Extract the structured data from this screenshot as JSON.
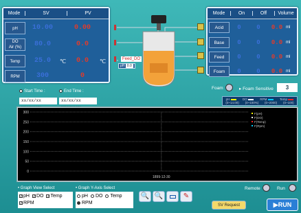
{
  "sensor_table": {
    "headers": [
      "Mode",
      "SV",
      "PV"
    ],
    "rows": [
      {
        "label": "pH",
        "sv": "10.00",
        "pv": "0.00",
        "unit": ""
      },
      {
        "label": "DO\nAir (%)",
        "label1": "DO",
        "label2": "Air (%)",
        "sv": "80.0",
        "pv": "0.0",
        "unit": ""
      },
      {
        "label": "Temp",
        "sv": "25.0",
        "pv": "0.0",
        "unit": "℃"
      },
      {
        "label": "RPM",
        "sv": "300",
        "pv": "0",
        "unit": ""
      }
    ]
  },
  "pump_table": {
    "headers": [
      "Mode",
      "On",
      "Off",
      "Volume"
    ],
    "rows": [
      {
        "label": "Acid",
        "on": "0",
        "off": "0",
        "vol": "0.0",
        "unit": "ml"
      },
      {
        "label": "Base",
        "on": "0",
        "off": "0",
        "vol": "0.0",
        "unit": "ml"
      },
      {
        "label": "Feed",
        "on": "0",
        "off": "0",
        "vol": "0.0",
        "unit": "ml"
      },
      {
        "label": "Foam",
        "on": "0",
        "off": "0",
        "vol": "0.0",
        "unit": "ml"
      }
    ]
  },
  "vessel": {
    "feed_label": "Feed_DO",
    "ph_label": "pH",
    "ph_value": "0.0"
  },
  "foam": {
    "label": "Foam",
    "sensitive_label": "Foam Sensitive",
    "sensitive_value": "3"
  },
  "times": {
    "start_label": "Start Time :",
    "end_label": "End Time :",
    "start_value": "xx/xx/xx xx:xx:xx",
    "end_value": "xx/xx/xx xx:xx:xx"
  },
  "chart_legend": {
    "ph": "pH",
    "ph_range": "(0~14.00)",
    "do": "DO",
    "do_range": "(0~100%)",
    "rpm": "RPM",
    "rpm_range": "(0~2000)",
    "temp": "Temp",
    "temp_range": "(0~100)"
  },
  "chart_data": {
    "type": "line",
    "y_ticks": [
      "300",
      "250",
      "200",
      "150",
      "100",
      "50",
      "0"
    ],
    "ylim": [
      0,
      300
    ],
    "x_label": "1899-12-30",
    "series_names": [
      "F(pH)",
      "F(DO)",
      "F(Temp)",
      "F(Rpm)"
    ],
    "series": []
  },
  "controls": {
    "graph_view_label": "Graph View Select",
    "graph_view": [
      {
        "label": "pH",
        "checked": true
      },
      {
        "label": "DO",
        "checked": true
      },
      {
        "label": "Temp",
        "checked": true
      },
      {
        "label": "RPM",
        "checked": true
      }
    ],
    "y_axis_label": "Graph Y-Axis Select",
    "y_axis": [
      {
        "label": "pH",
        "selected": false
      },
      {
        "label": "DO",
        "selected": false
      },
      {
        "label": "Temp",
        "selected": false
      },
      {
        "label": "RPM",
        "selected": true
      }
    ],
    "remote_label": "Remote",
    "run_label": "Run",
    "sv_request": "SV Request",
    "run_button": "RUN"
  }
}
